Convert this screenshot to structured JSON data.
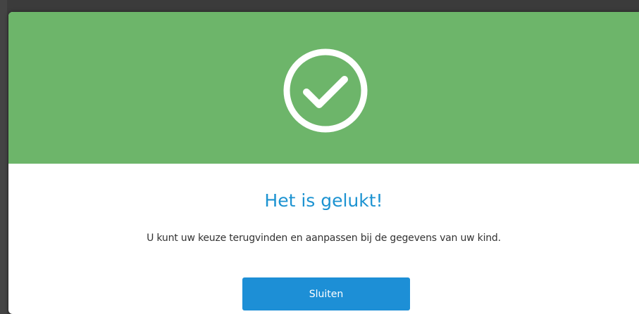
{
  "theme": {
    "header_color": "#6db56a",
    "title_color": "#1d93d1",
    "button_color": "#1d8fd6",
    "icon": "check-circle-icon"
  },
  "dialog": {
    "title": "Het is gelukt!",
    "message": "U kunt uw keuze terugvinden en aanpassen bij de gegevens van uw kind.",
    "close_label": "Sluiten"
  }
}
